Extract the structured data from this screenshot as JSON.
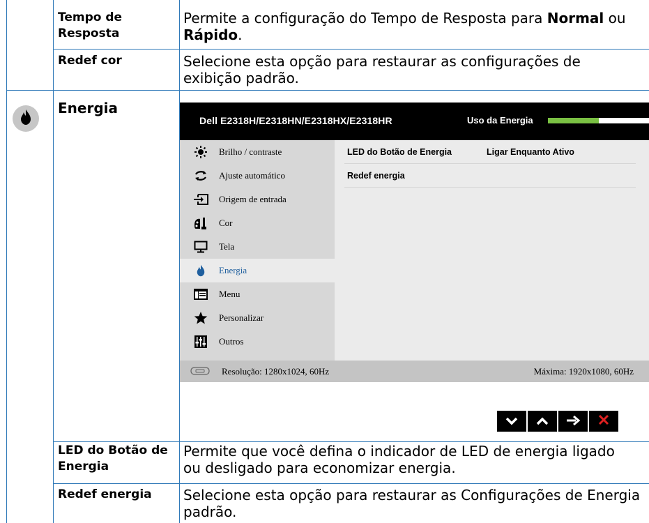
{
  "rows": {
    "response_time": {
      "label": "Tempo de Resposta",
      "text_before": "Permite a configuração do Tempo de Resposta para ",
      "opt1": "Normal",
      "text_mid": " ou ",
      "opt2": "Rápido",
      "text_after": "."
    },
    "reset_color": {
      "label": "Redef cor",
      "text": "Selecione esta opção para restaurar as configurações de exibição padrão."
    },
    "energy": {
      "label": "Energia",
      "icon": "flame-icon"
    },
    "led": {
      "label": "LED do Botão de Energia",
      "text": "Permite que você defina o indicador de LED de energia ligado ou desligado para economizar energia."
    },
    "reset_energy": {
      "label": "Redef energia",
      "text": "Selecione esta opção para restaurar as Configurações de Energia padrão."
    }
  },
  "osd": {
    "title": "Dell E2318H/E2318HN/E2318HX/E2318HR",
    "usage_label": "Uso da Energia",
    "usage_level": 0.5,
    "colors": {
      "bar_fill": "#7ac143",
      "active_text": "#1f5f9e",
      "close": "#e02020"
    },
    "menu": [
      {
        "label": "Brilho / contraste",
        "icon": "sun-icon"
      },
      {
        "label": "Ajuste automático",
        "icon": "auto-adjust-icon"
      },
      {
        "label": "Origem de entrada",
        "icon": "input-source-icon"
      },
      {
        "label": "Cor",
        "icon": "color-icon"
      },
      {
        "label": "Tela",
        "icon": "display-icon"
      },
      {
        "label": "Energia",
        "icon": "flame-icon",
        "active": true
      },
      {
        "label": "Menu",
        "icon": "menu-icon"
      },
      {
        "label": "Personalizar",
        "icon": "star-icon"
      },
      {
        "label": "Outros",
        "icon": "sliders-icon"
      }
    ],
    "submenu": [
      {
        "label": "LED do Botão de Energia",
        "value": "Ligar Enquanto Ativo"
      },
      {
        "label": "Redef energia",
        "value": ""
      }
    ],
    "status": {
      "resolution": "Resolução: 1280x1024, 60Hz",
      "max": "Máxima: 1920x1080, 60Hz"
    },
    "nav": [
      "down-icon",
      "up-icon",
      "right-arrow-icon",
      "close-icon"
    ]
  }
}
